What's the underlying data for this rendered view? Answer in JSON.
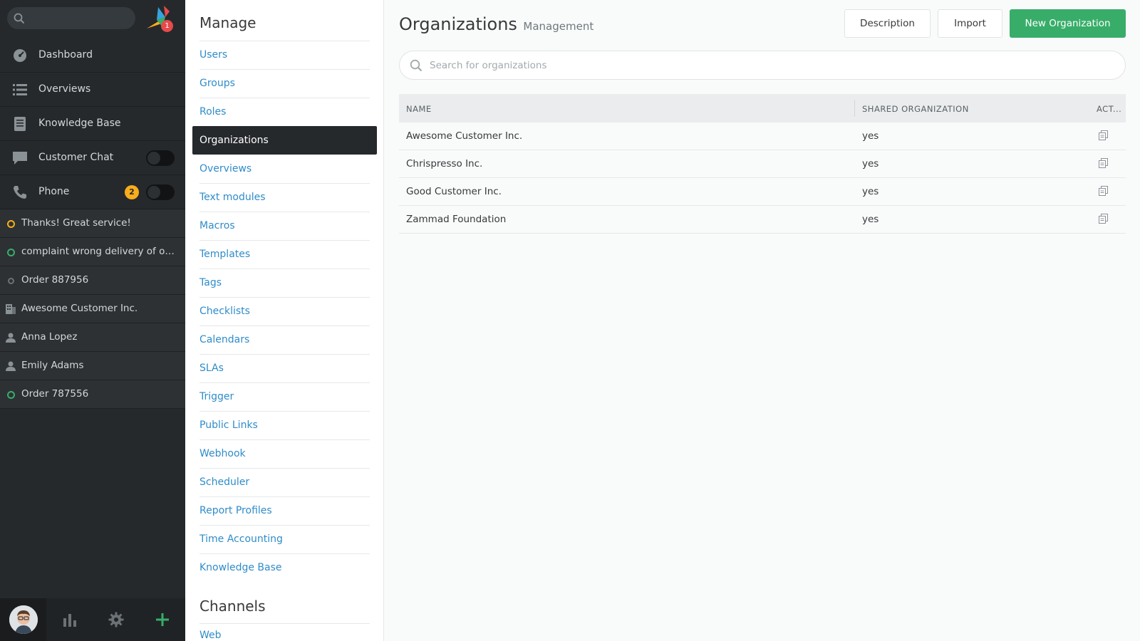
{
  "nav": {
    "search_placeholder": "",
    "logo_badge": "1",
    "menu": [
      {
        "label": "Dashboard",
        "icon": "dashboard-icon"
      },
      {
        "label": "Overviews",
        "icon": "list-icon"
      },
      {
        "label": "Knowledge Base",
        "icon": "book-icon"
      },
      {
        "label": "Customer Chat",
        "icon": "chat-icon"
      },
      {
        "label": "Phone",
        "icon": "phone-icon",
        "badge": "2"
      }
    ],
    "tasks": [
      {
        "label": "Thanks! Great service!",
        "icon": "ticket-status-icon",
        "color": "#f8ad1c"
      },
      {
        "label": "complaint wrong delivery of ord...",
        "icon": "ticket-status-icon",
        "color": "#38ad69"
      },
      {
        "label": "Order 887956",
        "icon": "ticket-status-icon",
        "color": "#6b7175"
      },
      {
        "label": "Awesome Customer Inc.",
        "icon": "organization-icon"
      },
      {
        "label": "Anna Lopez",
        "icon": "user-icon"
      },
      {
        "label": "Emily Adams",
        "icon": "user-icon"
      },
      {
        "label": "Order 787556",
        "icon": "ticket-status-icon",
        "color": "#38ad69"
      }
    ]
  },
  "admin": {
    "manage_heading": "Manage",
    "items": [
      "Users",
      "Groups",
      "Roles",
      "Organizations",
      "Overviews",
      "Text modules",
      "Macros",
      "Templates",
      "Tags",
      "Checklists",
      "Calendars",
      "SLAs",
      "Trigger",
      "Public Links",
      "Webhook",
      "Scheduler",
      "Report Profiles",
      "Time Accounting",
      "Knowledge Base"
    ],
    "active_item": "Organizations",
    "channels_heading": "Channels",
    "channels_first": "Web"
  },
  "main": {
    "title": "Organizations",
    "subtitle": "Management",
    "buttons": {
      "description": "Description",
      "import": "Import",
      "new": "New Organization"
    },
    "search_placeholder": "Search for organizations",
    "table": {
      "headers": {
        "name": "NAME",
        "shared": "SHARED ORGANIZATION",
        "actions": "ACT..."
      },
      "rows": [
        {
          "name": "Awesome Customer Inc.",
          "shared": "yes"
        },
        {
          "name": "Chrispresso Inc.",
          "shared": "yes"
        },
        {
          "name": "Good Customer Inc.",
          "shared": "yes"
        },
        {
          "name": "Zammad Foundation",
          "shared": "yes"
        }
      ]
    }
  },
  "colors": {
    "accent_green": "#38ad69",
    "link_blue": "#2f8cc9",
    "nav_bg": "#26292c",
    "badge_yellow": "#f8ad1c",
    "badge_red": "#e54b4b"
  }
}
